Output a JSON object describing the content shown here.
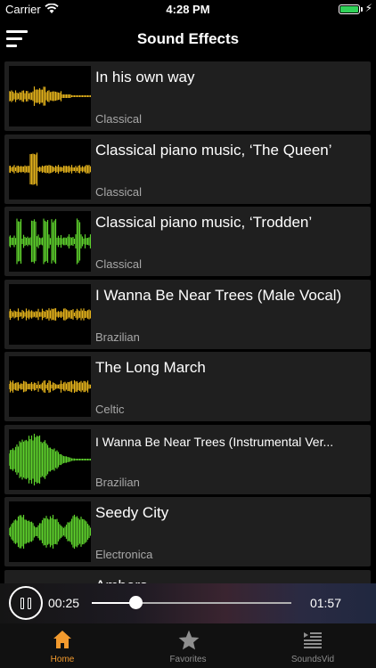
{
  "status": {
    "carrier": "Carrier",
    "time": "4:28 PM"
  },
  "nav": {
    "title": "Sound Effects"
  },
  "tracks": [
    {
      "title": "In his own way",
      "genre": "Classical",
      "wave": "yellow-flat"
    },
    {
      "title": "Classical piano music, ‘The Queen’",
      "genre": "Classical",
      "wave": "yellow-burst"
    },
    {
      "title": "Classical piano music, ‘Trodden’",
      "genre": "Classical",
      "wave": "green-spikes"
    },
    {
      "title": "I Wanna Be Near Trees (Male Vocal)",
      "genre": "Brazilian",
      "wave": "yellow-dense"
    },
    {
      "title": "The Long March",
      "genre": "Celtic",
      "wave": "yellow-dense"
    },
    {
      "title": "I Wanna Be Near Trees (Instrumental Ver...",
      "genre": "Brazilian",
      "wave": "green-swell"
    },
    {
      "title": "Seedy City",
      "genre": "Electronica",
      "wave": "green-bulbs"
    },
    {
      "title": "Ambers",
      "genre": "",
      "wave": "none"
    }
  ],
  "player": {
    "current_time": "00:25",
    "total_time": "01:57",
    "progress": 0.22
  },
  "tabs": [
    {
      "label": "Home",
      "icon": "home-icon",
      "active": true
    },
    {
      "label": "Favorites",
      "icon": "star-icon",
      "active": false
    },
    {
      "label": "SoundsVid",
      "icon": "video-list-icon",
      "active": false
    }
  ],
  "colors": {
    "accent": "#f29a2e",
    "wave_yellow": "#e3b21c",
    "wave_green": "#5ed12d"
  }
}
